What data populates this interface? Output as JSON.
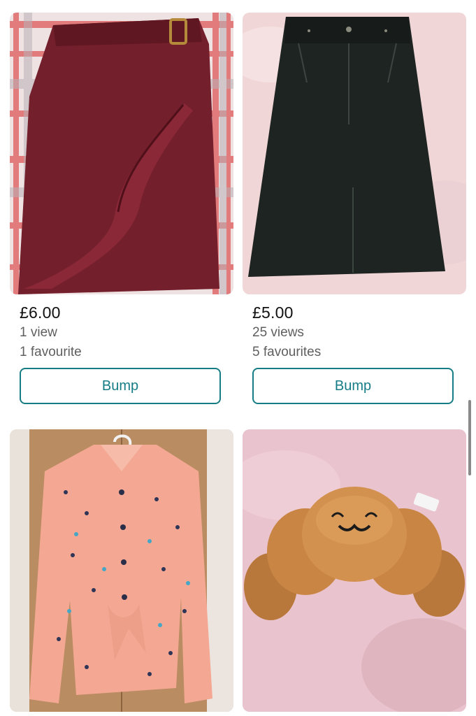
{
  "listings": [
    {
      "image": "burgundy-skirt-photo",
      "price": "£6.00",
      "views": "1 view",
      "favourites": "1 favourite",
      "bump_label": "Bump"
    },
    {
      "image": "black-denim-skirt-photo",
      "price": "£5.00",
      "views": "25 views",
      "favourites": "5 favourites",
      "bump_label": "Bump"
    },
    {
      "image": "pink-print-blouse-photo"
    },
    {
      "image": "croissant-plush-photo"
    }
  ],
  "colors": {
    "accent": "#167d86",
    "price_text": "#111111",
    "meta_text": "#5f5f5f"
  }
}
